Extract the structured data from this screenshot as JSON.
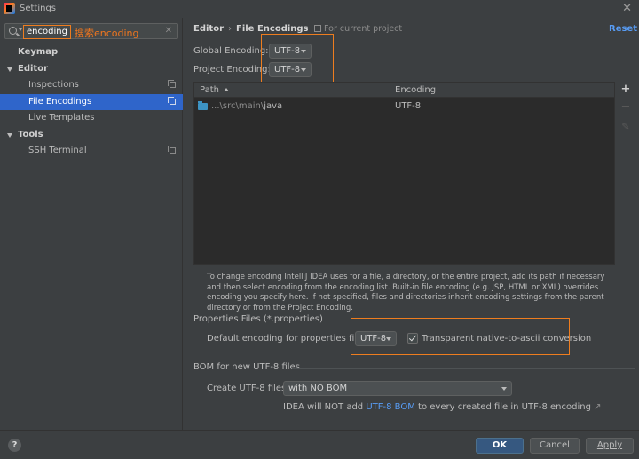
{
  "window": {
    "title": "Settings",
    "close": "✕"
  },
  "search": {
    "value": "encoding",
    "annotation": "搜索encoding",
    "clear": "✕"
  },
  "sidebar": {
    "items": [
      {
        "label": "Keymap",
        "bold": true
      },
      {
        "label": "Editor",
        "bold": true,
        "expanded": true
      },
      {
        "label": "Inspections",
        "child": true
      },
      {
        "label": "File Encodings",
        "child": true,
        "selected": true
      },
      {
        "label": "Live Templates",
        "child": true
      },
      {
        "label": "Tools",
        "bold": true,
        "expanded": true
      },
      {
        "label": "SSH Terminal",
        "child": true
      }
    ]
  },
  "header": {
    "crumb_parent": "Editor",
    "crumb_sep": "›",
    "crumb_current": "File Encodings",
    "project_note": "For current project",
    "reset": "Reset"
  },
  "encodings": {
    "global_label": "Global Encoding:",
    "global_value": "UTF-8",
    "project_label": "Project Encoding:",
    "project_value": "UTF-8"
  },
  "table": {
    "col_path": "Path",
    "col_encoding": "Encoding",
    "rows": [
      {
        "path_dim": "...\\src\\main\\",
        "path_main": "java",
        "encoding": "UTF-8"
      }
    ],
    "tools": {
      "add": "+",
      "remove": "−",
      "edit": "✎"
    }
  },
  "note": "To change encoding IntelliJ IDEA uses for a file, a directory, or the entire project, add its path if necessary and then select encoding from the encoding list. Built-in file encoding (e.g. JSP, HTML or XML) overrides encoding you specify here. If not specified, files and directories inherit encoding settings from the parent directory or from the Project Encoding.",
  "properties": {
    "section": "Properties Files (*.properties)",
    "default_label": "Default encoding for properties files:",
    "default_value": "UTF-8",
    "native_checked": true,
    "native_label": "Transparent native-to-ascii conversion"
  },
  "bom": {
    "section": "BOM for new UTF-8 files",
    "create_label": "Create UTF-8 files:",
    "create_value": "with NO BOM",
    "note_pre": "IDEA will NOT add",
    "note_link": "UTF-8 BOM",
    "note_post": "to every created file in UTF-8 encoding",
    "note_arrow": "↗"
  },
  "footer": {
    "help": "?",
    "ok": "OK",
    "cancel": "Cancel",
    "apply": "Apply"
  },
  "colors": {
    "background": "#3c3f41",
    "selection": "#2f65ca",
    "highlight": "#ee7d1f",
    "link": "#589df6",
    "ok_button": "#365880"
  }
}
